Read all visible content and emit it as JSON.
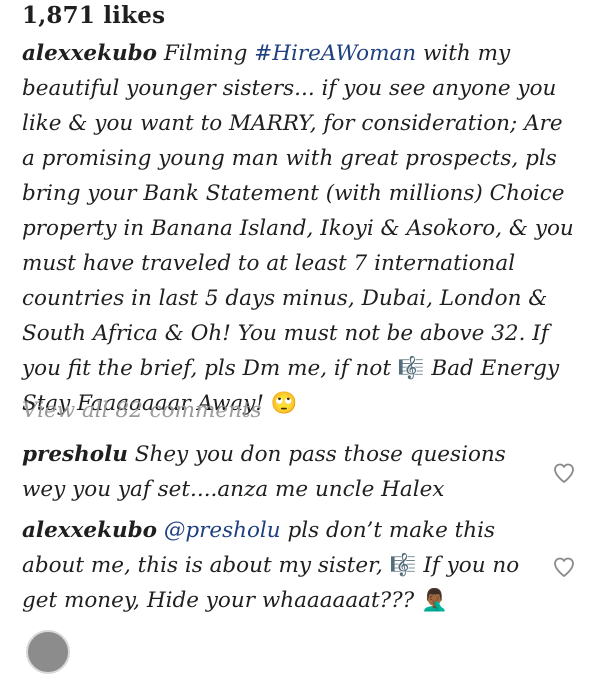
{
  "post": {
    "likes": "1,871 likes",
    "caption_user": "alexxekubo",
    "caption_text_1": " Filming ",
    "hashtag": "#HireAWoman",
    "caption_text_2": " with my beautiful younger sisters... if you see anyone you like & you want to MARRY, for consideration;  Are a promising young man with great prospects, pls bring your Bank Statement (with millions) Choice property in Banana Island, Ikoyi & Asokoro, & you must have traveled to at least 7 international countries in last 5 days minus, Dubai, London & South Africa & Oh! You must not be above 32. If you fit the brief, pls Dm me, if not ",
    "emoji_music": "🎼",
    "caption_text_3": " Bad Energy Stay Faaaaaaar Away! ",
    "emoji_eyeroll": "🙄",
    "view_all": "View all 82 comments"
  },
  "comments": [
    {
      "user": "presholu",
      "text": " Shey you don pass those quesions wey you yaf set....anza me uncle Halex"
    },
    {
      "user": "alexxekubo",
      "mention": " @presholu",
      "text_1": " pls don’t make this about me, this is about my sister, ",
      "emoji_music": "🎼",
      "text_2": " If you no get money, Hide your whaaaaaat??? ",
      "emoji_facepalm": "🤦🏾‍♂️"
    }
  ],
  "icons": {
    "like": "heart-icon",
    "avatar": "avatar"
  }
}
